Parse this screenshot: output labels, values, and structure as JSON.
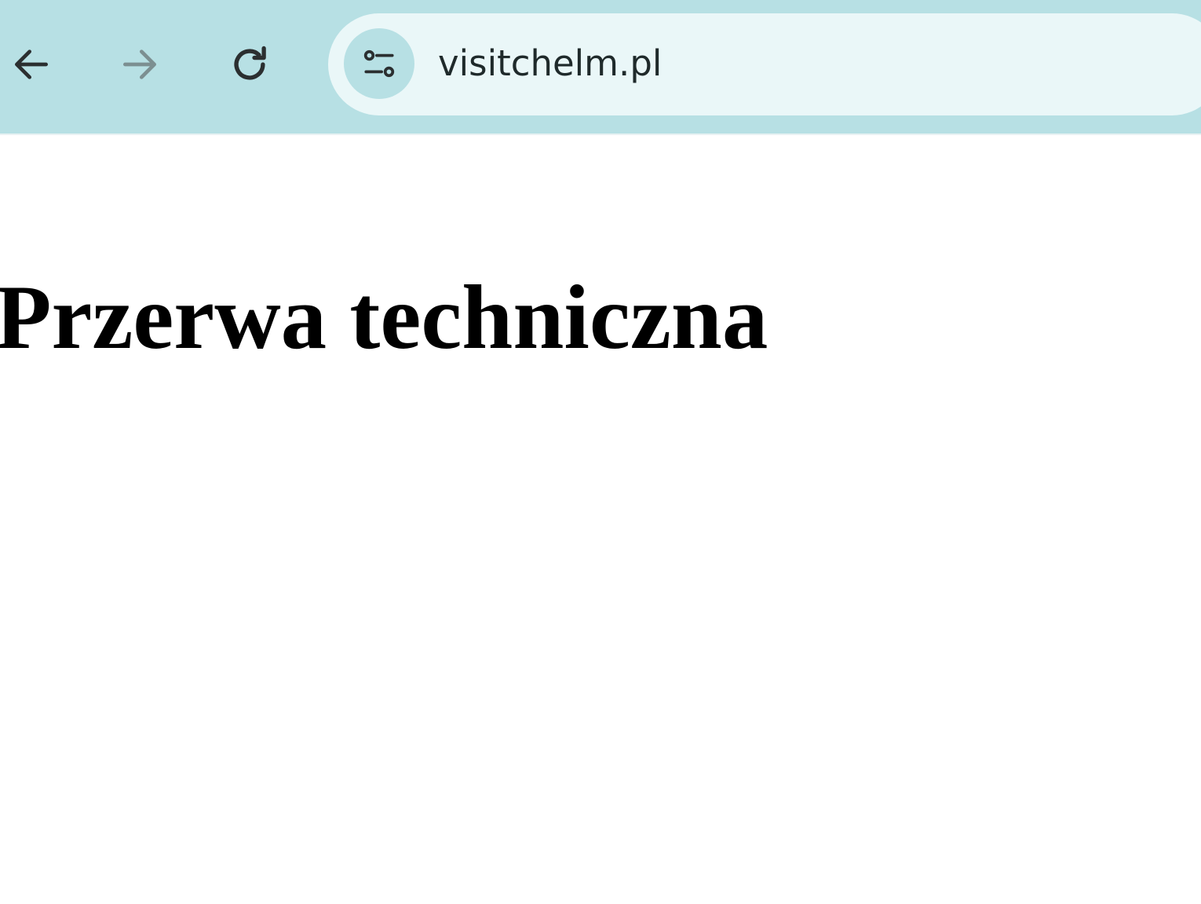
{
  "browser": {
    "toolbar_color": "#b7e0e4",
    "omnibox_color": "#eaf7f8",
    "url": "visitchelm.pl",
    "icons": {
      "back": "arrow-left-icon",
      "forward": "arrow-right-icon",
      "reload": "reload-icon",
      "site_info": "tune-icon"
    }
  },
  "page": {
    "heading": "Przerwa techniczna"
  }
}
